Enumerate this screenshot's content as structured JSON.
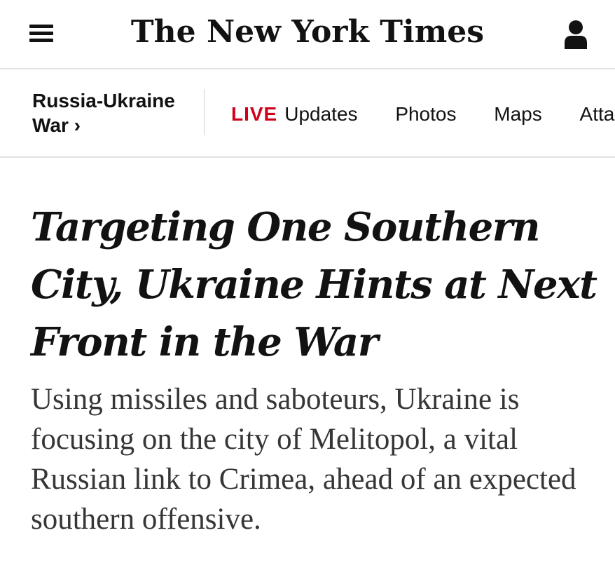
{
  "masthead": {
    "logo": "The New York Times",
    "menu_icon": "hamburger-menu-icon",
    "account_icon": "user-account-icon"
  },
  "section_nav": {
    "section_title_line1": "Russia-Ukraine",
    "section_title_line2": "War ›",
    "live_badge": "LIVE",
    "links": [
      "Updates",
      "Photos",
      "Maps",
      "Attacks"
    ]
  },
  "article": {
    "headline": "Targeting One Southern City, Ukraine Hints at Next Front in the War",
    "summary": "Using missiles and saboteurs, Ukraine is focusing on the city of Melitopol, a vital Russian link to Crimea, ahead of an expected southern offensive."
  },
  "colors": {
    "live_red": "#d0021b",
    "text": "#121212",
    "summary_text": "#363636",
    "divider": "#e2e2e2"
  }
}
